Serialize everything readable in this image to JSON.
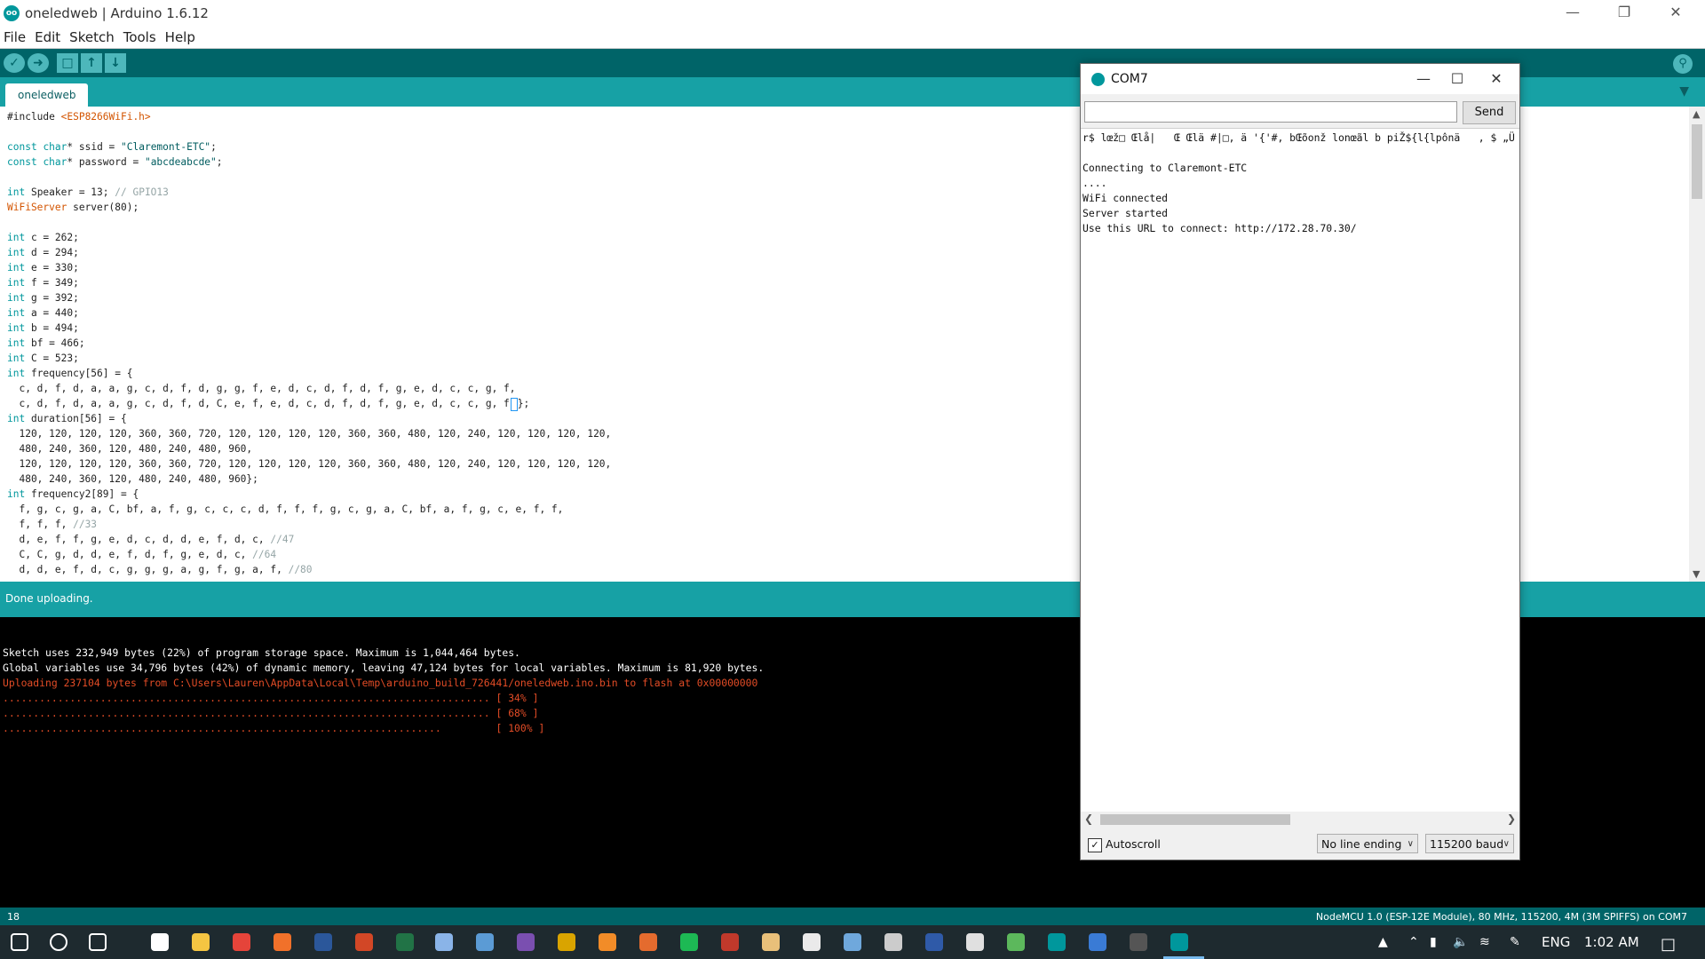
{
  "window": {
    "title": "oneledweb | Arduino 1.6.12",
    "icon_label": "oo",
    "controls": [
      "minimize",
      "restore",
      "close"
    ]
  },
  "menu": [
    "File",
    "Edit",
    "Sketch",
    "Tools",
    "Help"
  ],
  "toolbar": {
    "buttons": [
      {
        "name": "verify",
        "icon": "check-icon"
      },
      {
        "name": "upload",
        "icon": "arrow-right-icon"
      },
      {
        "name": "new",
        "icon": "new-file-icon"
      },
      {
        "name": "open",
        "icon": "arrow-up-icon"
      },
      {
        "name": "save",
        "icon": "arrow-down-icon"
      }
    ],
    "serial_icon": "magnifier-icon"
  },
  "tabs": [
    {
      "label": "oneledweb"
    }
  ],
  "editor": {
    "lines": [
      "#include <ESP8266WiFi.h>",
      "",
      "const char* ssid = \"Claremont-ETC\";",
      "const char* password = \"abcdeabcde\";",
      "",
      "int Speaker = 13; // GPIO13",
      "WiFiServer server(80);",
      "",
      "int c = 262;",
      "int d = 294;",
      "int e = 330;",
      "int f = 349;",
      "int g = 392;",
      "int a = 440;",
      "int b = 494;",
      "int bf = 466;",
      "int C = 523;",
      "int frequency[56] = {",
      "  c, d, f, d, a, a, g, c, d, f, d, g, g, f, e, d, c, d, f, d, f, g, e, d, c, c, g, f,",
      "  c, d, f, d, a, a, g, c, d, f, d, C, e, f, e, d, c, d, f, d, f, g, e, d, c, c, g, f};",
      "int duration[56] = {",
      "  120, 120, 120, 120, 360, 360, 720, 120, 120, 120, 120, 360, 360, 480, 120, 240, 120, 120, 120, 120,",
      "  480, 240, 360, 120, 480, 240, 480, 960,",
      "  120, 120, 120, 120, 360, 360, 720, 120, 120, 120, 120, 360, 360, 480, 120, 240, 120, 120, 120, 120,",
      "  480, 240, 360, 120, 480, 240, 480, 960};",
      "int frequency2[89] = {",
      "  f, g, c, g, a, C, bf, a, f, g, c, c, c, d, f, f, f, g, c, g, a, C, bf, a, f, g, c, e, f, f,",
      "  f, f, f, //33",
      "  d, e, f, f, g, e, d, c, d, d, e, f, d, c, //47",
      "  C, C, g, d, d, e, f, d, f, g, e, d, c, //64",
      "  d, d, e, f, d, c, g, g, g, a, g, f, g, a, f, //80"
    ]
  },
  "status": {
    "message": "Done uploading."
  },
  "console": {
    "lines": [
      {
        "text": "",
        "type": "info"
      },
      {
        "text": "Sketch uses 232,949 bytes (22%) of program storage space. Maximum is 1,044,464 bytes.",
        "type": "info"
      },
      {
        "text": "Global variables use 34,796 bytes (42%) of dynamic memory, leaving 47,124 bytes for local variables. Maximum is 81,920 bytes.",
        "type": "info"
      },
      {
        "text": "Uploading 237104 bytes from C:\\Users\\Lauren\\AppData\\Local\\Temp\\arduino_build_726441/oneledweb.ino.bin to flash at 0x00000000",
        "type": "err"
      },
      {
        "text": "................................................................................ [ 34% ]",
        "type": "err"
      },
      {
        "text": "................................................................................ [ 68% ]",
        "type": "err"
      },
      {
        "text": "........................................................................         [ 100% ]",
        "type": "err"
      }
    ]
  },
  "infobar": {
    "line_number": "18",
    "board": "NodeMCU 1.0 (ESP-12E Module), 80 MHz, 115200, 4M (3M SPIFFS) on COM7"
  },
  "serial_monitor": {
    "title": "COM7",
    "input_value": "",
    "send_label": "Send",
    "output": [
      "r$ lœž□ Œlå|   Œ Œlä #|□, ä '{'#, bŒõonž lonœãl b piŽ${l{lpônä   , $ „Ü",
      "",
      "Connecting to Claremont-ETC",
      "....",
      "WiFi connected",
      "Server started",
      "Use this URL to connect: http://172.28.70.30/"
    ],
    "autoscroll_label": "Autoscroll",
    "autoscroll_checked": true,
    "line_ending": "No line ending",
    "baud": "115200 baud"
  },
  "taskbar": {
    "apps": [
      {
        "name": "start",
        "color": "#ffffff"
      },
      {
        "name": "search",
        "color": "#ffffff"
      },
      {
        "name": "task-view",
        "color": "#ffffff"
      },
      {
        "name": "home",
        "color": "#ffffff"
      },
      {
        "name": "file-explorer",
        "color": "#f4c542"
      },
      {
        "name": "chrome",
        "color": "#e5443a"
      },
      {
        "name": "firefox",
        "color": "#f1712a"
      },
      {
        "name": "word",
        "color": "#2b579a"
      },
      {
        "name": "powerpoint",
        "color": "#d24726"
      },
      {
        "name": "excel",
        "color": "#217346"
      },
      {
        "name": "steam",
        "color": "#8ab4e8"
      },
      {
        "name": "app-blue",
        "color": "#5b9bd5"
      },
      {
        "name": "app-purple",
        "color": "#7a4fb0"
      },
      {
        "name": "app-yellow",
        "color": "#d9a400"
      },
      {
        "name": "app-orange",
        "color": "#f28c28"
      },
      {
        "name": "matlab",
        "color": "#e46b2e"
      },
      {
        "name": "spotify",
        "color": "#1db954"
      },
      {
        "name": "app-red",
        "color": "#c0392b"
      },
      {
        "name": "app-zip",
        "color": "#e8c07a"
      },
      {
        "name": "itunes",
        "color": "#eaeaea"
      },
      {
        "name": "app-blue2",
        "color": "#6fa8dc"
      },
      {
        "name": "app-gray",
        "color": "#cccccc"
      },
      {
        "name": "app-l",
        "color": "#2f5aa8"
      },
      {
        "name": "app-cloud",
        "color": "#e0e0e0"
      },
      {
        "name": "app-green",
        "color": "#5cb85c"
      },
      {
        "name": "arduino",
        "color": "#00979c"
      },
      {
        "name": "app-sync",
        "color": "#3a7bd5"
      },
      {
        "name": "app-term",
        "color": "#555555"
      },
      {
        "name": "arduino-active",
        "color": "#00979c"
      }
    ],
    "lang": "ENG",
    "time": "1:02 AM"
  }
}
